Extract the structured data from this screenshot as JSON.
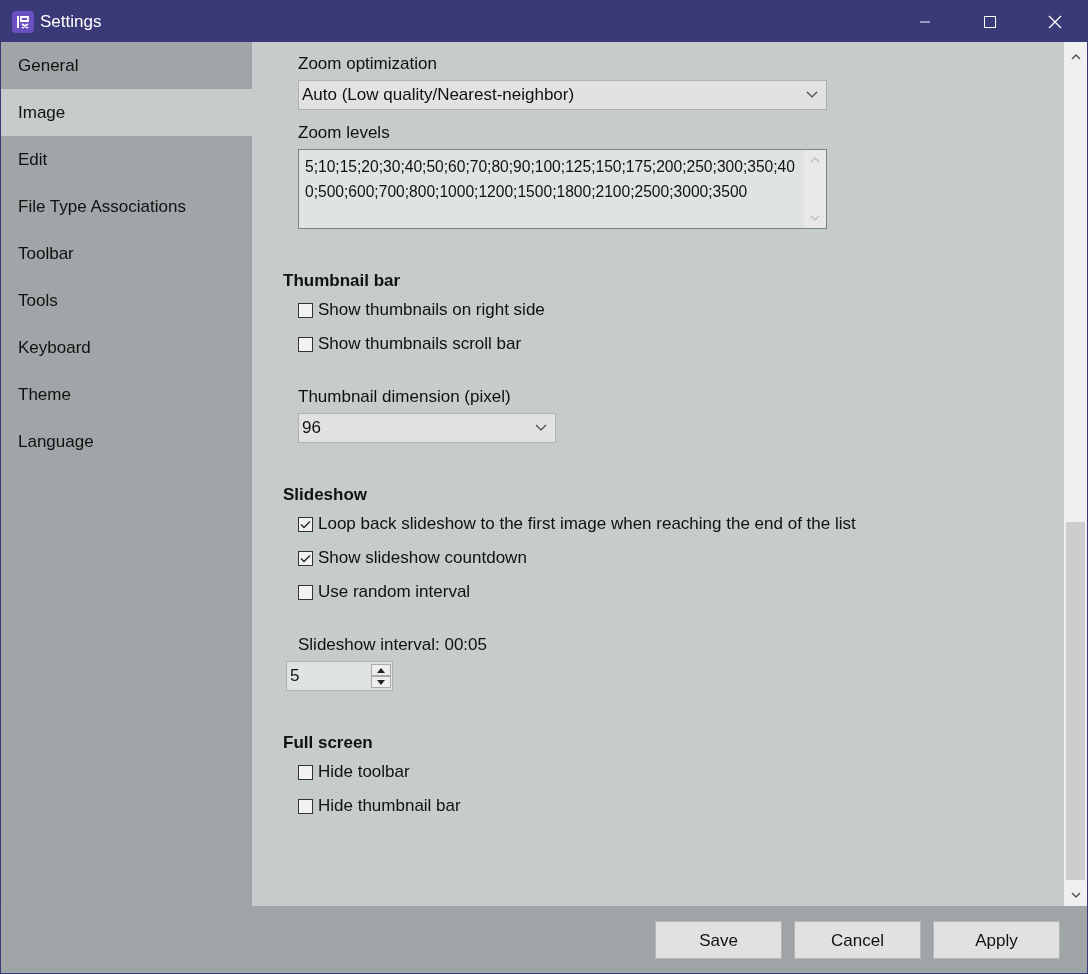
{
  "window": {
    "title": "Settings"
  },
  "sidebar": {
    "items": [
      {
        "label": "General",
        "selected": false
      },
      {
        "label": "Image",
        "selected": true
      },
      {
        "label": "Edit",
        "selected": false
      },
      {
        "label": "File Type Associations",
        "selected": false
      },
      {
        "label": "Toolbar",
        "selected": false
      },
      {
        "label": "Tools",
        "selected": false
      },
      {
        "label": "Keyboard",
        "selected": false
      },
      {
        "label": "Theme",
        "selected": false
      },
      {
        "label": "Language",
        "selected": false
      }
    ]
  },
  "sections": [
    {
      "items": [
        {
          "kind": "label",
          "text": "Zoom optimization"
        },
        {
          "kind": "dropdown",
          "value": "Auto (Low quality/Nearest-neighbor)",
          "wide": true
        },
        {
          "kind": "label",
          "text": "Zoom levels"
        },
        {
          "kind": "textarea",
          "value": "5;10;15;20;30;40;50;60;70;80;90;100;125;150;175;200;250;300;350;400;500;600;700;800;1000;1200;1500;1800;2100;2500;3000;3500"
        }
      ]
    },
    {
      "heading": "Thumbnail bar",
      "items": [
        {
          "kind": "checkbox",
          "label": "Show thumbnails on right side",
          "checked": false
        },
        {
          "kind": "checkbox",
          "label": "Show thumbnails scroll bar",
          "checked": false
        },
        {
          "kind": "label",
          "text": "Thumbnail dimension (pixel)"
        },
        {
          "kind": "dropdown",
          "value": "96",
          "wide": false
        }
      ]
    },
    {
      "heading": "Slideshow",
      "items": [
        {
          "kind": "checkbox",
          "label": "Loop back slideshow to the first image when reaching the end of the list",
          "checked": true
        },
        {
          "kind": "checkbox",
          "label": "Show slideshow countdown",
          "checked": true
        },
        {
          "kind": "checkbox",
          "label": "Use random interval",
          "checked": false
        },
        {
          "kind": "label",
          "text": "Slideshow interval: 00:05"
        },
        {
          "kind": "spinner",
          "value": "5"
        }
      ]
    },
    {
      "heading": "Full screen",
      "items": [
        {
          "kind": "checkbox",
          "label": "Hide toolbar",
          "checked": false
        },
        {
          "kind": "checkbox",
          "label": "Hide thumbnail bar",
          "checked": false
        }
      ]
    }
  ],
  "buttons": [
    "Save",
    "Cancel",
    "Apply"
  ]
}
